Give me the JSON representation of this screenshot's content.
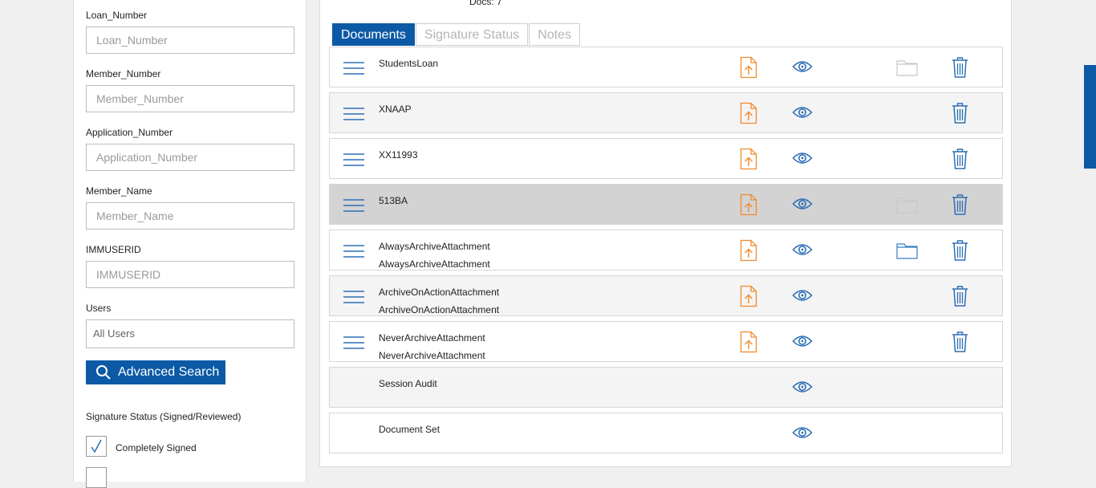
{
  "filters": {
    "loan_number": {
      "label": "Loan_Number",
      "placeholder": "Loan_Number"
    },
    "member_number": {
      "label": "Member_Number",
      "placeholder": "Member_Number"
    },
    "application_number": {
      "label": "Application_Number",
      "placeholder": "Application_Number"
    },
    "member_name": {
      "label": "Member_Name",
      "placeholder": "Member_Name"
    },
    "immuserid": {
      "label": "IMMUSERID",
      "placeholder": "IMMUSERID"
    },
    "users": {
      "label": "Users",
      "value": "All Users"
    },
    "advanced_search_label": "Advanced Search",
    "signature_status_label": "Signature Status (Signed/Reviewed)",
    "checkboxes": [
      {
        "label": "Completely Signed",
        "checked": true
      }
    ]
  },
  "main": {
    "docs_count": "Docs: 7",
    "tabs": [
      {
        "label": "Documents",
        "active": true
      },
      {
        "label": "Signature Status",
        "active": false
      },
      {
        "label": "Notes",
        "active": false
      }
    ],
    "documents": [
      {
        "name": "StudentsLoan",
        "sub": "",
        "has_menu": true,
        "has_upload": true,
        "has_eye": true,
        "folder": "light",
        "has_trash": true,
        "style": "normal"
      },
      {
        "name": "XNAAP",
        "sub": "",
        "has_menu": true,
        "has_upload": true,
        "has_eye": true,
        "folder": "none",
        "has_trash": true,
        "style": "alt"
      },
      {
        "name": "XX11993",
        "sub": "",
        "has_menu": true,
        "has_upload": true,
        "has_eye": true,
        "folder": "none",
        "has_trash": true,
        "style": "normal"
      },
      {
        "name": "513BA",
        "sub": "",
        "has_menu": true,
        "has_upload": true,
        "has_eye": true,
        "folder": "light",
        "has_trash": true,
        "style": "selected"
      },
      {
        "name": "AlwaysArchiveAttachment",
        "sub": "AlwaysArchiveAttachment",
        "has_menu": true,
        "has_upload": true,
        "has_eye": true,
        "folder": "blue",
        "has_trash": true,
        "style": "normal"
      },
      {
        "name": "ArchiveOnActionAttachment",
        "sub": "ArchiveOnActionAttachment",
        "has_menu": true,
        "has_upload": true,
        "has_eye": true,
        "folder": "none",
        "has_trash": true,
        "style": "alt"
      },
      {
        "name": "NeverArchiveAttachment",
        "sub": "NeverArchiveAttachment",
        "has_menu": true,
        "has_upload": true,
        "has_eye": true,
        "folder": "none",
        "has_trash": true,
        "style": "normal"
      },
      {
        "name": "Session Audit",
        "sub": "",
        "has_menu": false,
        "has_upload": false,
        "has_eye": true,
        "folder": "none",
        "has_trash": false,
        "style": "alt"
      },
      {
        "name": "Document Set",
        "sub": "",
        "has_menu": false,
        "has_upload": false,
        "has_eye": true,
        "folder": "none",
        "has_trash": false,
        "style": "normal"
      }
    ]
  },
  "colors": {
    "primary": "#0c5aa6",
    "upload": "#f08a2c",
    "icon_blue": "#2d6fb5",
    "folder_light": "#c8c8c8",
    "folder_blue": "#3a7cc2"
  },
  "icons": {
    "menu": "hamburger-icon",
    "upload": "upload-icon",
    "view": "eye-icon",
    "folder": "folder-icon",
    "delete": "trash-icon",
    "search": "search-icon",
    "check": "check-icon"
  }
}
